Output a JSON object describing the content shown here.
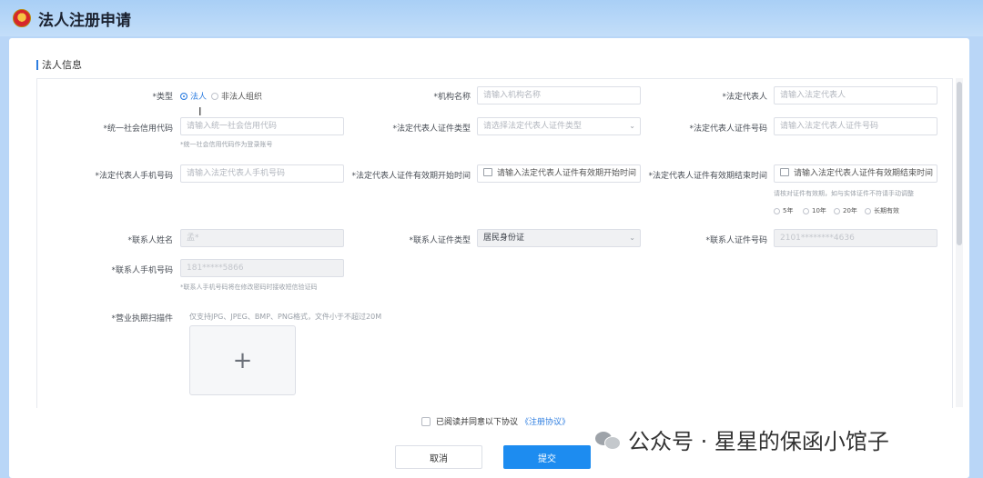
{
  "app": {
    "title": "法人注册申请"
  },
  "section": {
    "title": "法人信息"
  },
  "form": {
    "type": {
      "label": "*类型",
      "option_a": "法人",
      "option_b": "非法人组织"
    },
    "org_name": {
      "label": "*机构名称",
      "placeholder": "请输入机构名称"
    },
    "legal_rep": {
      "label": "*法定代表人",
      "placeholder": "请输入法定代表人"
    },
    "credit_code": {
      "label": "*统一社会信用代码",
      "placeholder": "请输入统一社会信用代码",
      "hint": "*统一社会信用代码作为登录账号"
    },
    "rep_id_type": {
      "label": "*法定代表人证件类型",
      "placeholder": "请选择法定代表人证件类型"
    },
    "rep_id_no": {
      "label": "*法定代表人证件号码",
      "placeholder": "请输入法定代表人证件号码"
    },
    "rep_phone": {
      "label": "*法定代表人手机号码",
      "placeholder": "请输入法定代表人手机号码"
    },
    "rep_id_start": {
      "label": "*法定代表人证件有效期开始时间",
      "placeholder": "请输入法定代表人证件有效期开始时间"
    },
    "rep_id_end": {
      "label": "*法定代表人证件有效期结束时间",
      "placeholder": "请输入法定代表人证件有效期结束时间",
      "hint": "请核对证件有效期，如与实体证件不符请手动调整",
      "options": [
        "5年",
        "10年",
        "20年",
        "长期有效"
      ]
    },
    "contact_name": {
      "label": "*联系人姓名",
      "value": "孟*"
    },
    "contact_id_type": {
      "label": "*联系人证件类型",
      "value": "居民身份证"
    },
    "contact_id_no": {
      "label": "*联系人证件号码",
      "value": "2101********4636"
    },
    "contact_phone": {
      "label": "*联系人手机号码",
      "value": "181*****5866",
      "hint": "*联系人手机号码将在修改密码时接收短信验证码"
    },
    "license": {
      "label": "*营业执照扫描件",
      "hint": "仅支持JPG、JPEG、BMP、PNG格式，文件小于不超过20M",
      "add_symbol": "+"
    }
  },
  "agreement": {
    "text": "已阅读并同意以下协议",
    "link": "《注册协议》"
  },
  "buttons": {
    "cancel": "取消",
    "submit": "提交"
  },
  "watermark": {
    "text": "公众号 · 星星的保函小馆子"
  }
}
